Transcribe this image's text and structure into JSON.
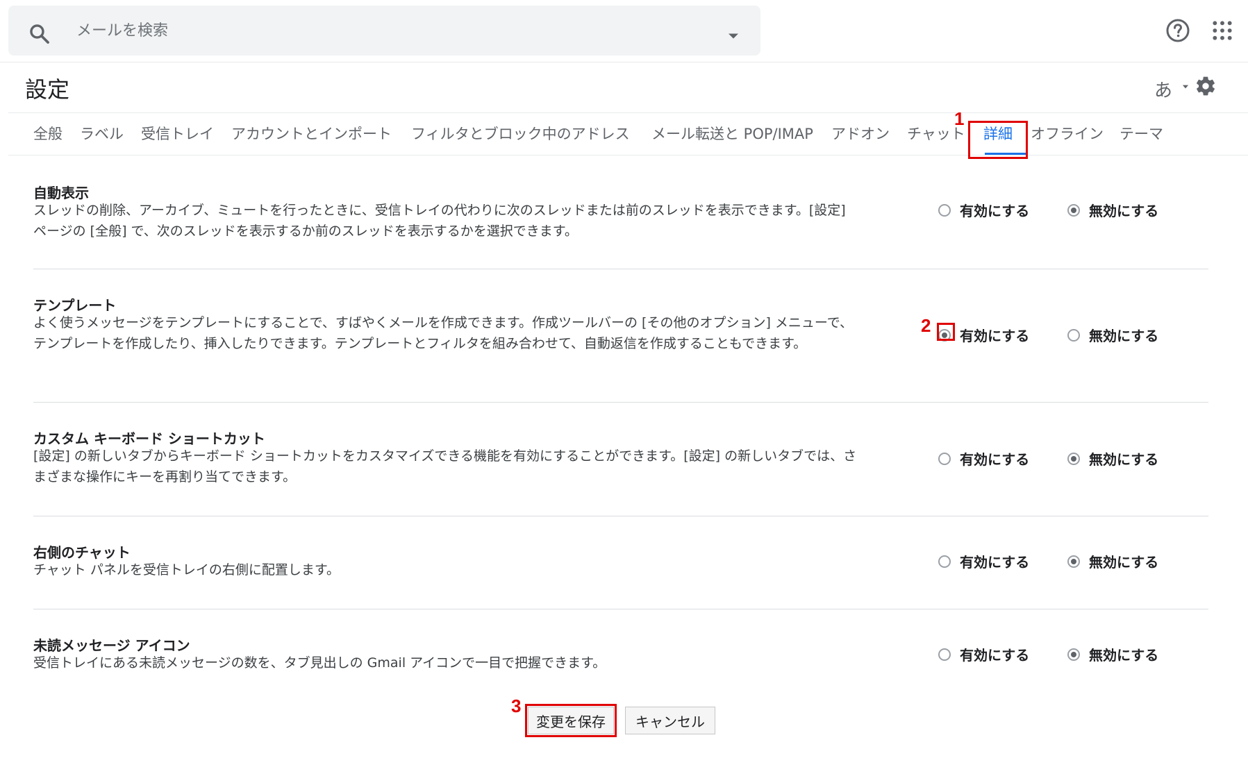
{
  "search": {
    "placeholder": "メールを検索"
  },
  "header": {
    "title": "設定",
    "ime_label": "あ"
  },
  "tabs": [
    {
      "label": "全般"
    },
    {
      "label": "ラベル"
    },
    {
      "label": "受信トレイ"
    },
    {
      "label": "アカウントとインポート"
    },
    {
      "label": "フィルタとブロック中のアドレス"
    },
    {
      "label": "メール転送と POP/IMAP"
    },
    {
      "label": "アドオン"
    },
    {
      "label": "チャット"
    },
    {
      "label": "詳細"
    },
    {
      "label": "オフライン"
    },
    {
      "label": "テーマ"
    }
  ],
  "sections": [
    {
      "title": "自動表示",
      "desc": "スレッドの削除、アーカイブ、ミュートを行ったときに、受信トレイの代わりに次のスレッドまたは前のスレッドを表示できます。[設定] ページの [全般] で、次のスレッドを表示するか前のスレッドを表示するかを選択できます。",
      "enable_label": "有効にする",
      "disable_label": "無効にする",
      "selected": "disable"
    },
    {
      "title": "テンプレート",
      "desc": "よく使うメッセージをテンプレートにすることで、すばやくメールを作成できます。作成ツールバーの [その他のオプション] メニューで、テンプレートを作成したり、挿入したりできます。テンプレートとフィルタを組み合わせて、自動返信を作成することもできます。",
      "enable_label": "有効にする",
      "disable_label": "無効にする",
      "selected": "enable"
    },
    {
      "title": "カスタム キーボード ショートカット",
      "desc": "[設定] の新しいタブからキーボード ショートカットをカスタマイズできる機能を有効にすることができます。[設定] の新しいタブでは、さまざまな操作にキーを再割り当てできます。",
      "enable_label": "有効にする",
      "disable_label": "無効にする",
      "selected": "disable"
    },
    {
      "title": "右側のチャット",
      "desc": "チャット パネルを受信トレイの右側に配置します。",
      "enable_label": "有効にする",
      "disable_label": "無効にする",
      "selected": "disable"
    },
    {
      "title": "未読メッセージ アイコン",
      "desc": "受信トレイにある未読メッセージの数を、タブ見出しの Gmail アイコンで一目で把握できます。",
      "enable_label": "有効にする",
      "disable_label": "無効にする",
      "selected": "disable"
    }
  ],
  "buttons": {
    "save_label": "変更を保存",
    "cancel_label": "キャンセル"
  },
  "annotations": [
    "1",
    "2",
    "3"
  ],
  "colors": {
    "accent": "#1a73e8",
    "annotation": "#e00000"
  }
}
